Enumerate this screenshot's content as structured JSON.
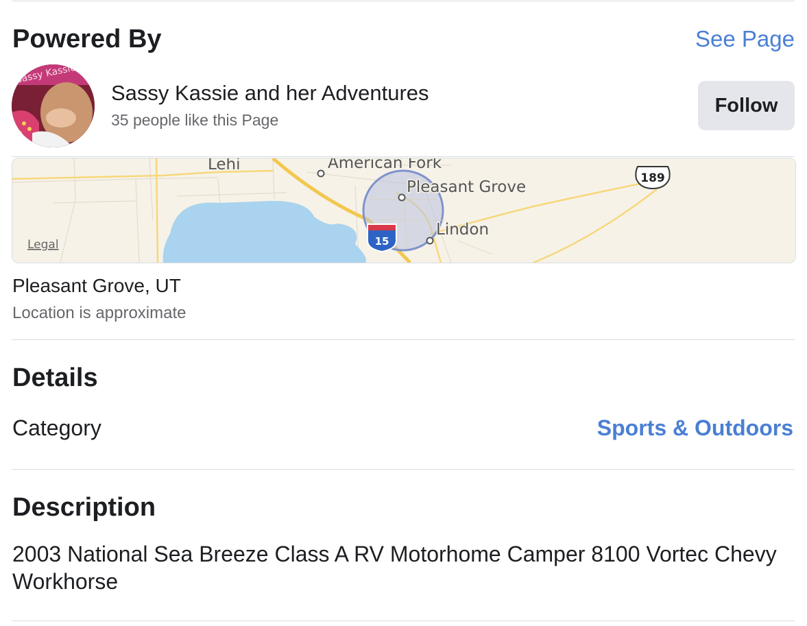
{
  "powered_by": {
    "title": "Powered By",
    "see_page_label": "See Page"
  },
  "page": {
    "name": "Sassy Kassie and her Adventures",
    "likes_text": "35 people like this Page",
    "follow_label": "Follow",
    "avatar_banner_text": "Sassy Kassie"
  },
  "map": {
    "labels": {
      "lehi": "Lehi",
      "american_fork": "American Fork",
      "pleasant_grove": "Pleasant Grove",
      "lindon": "Lindon",
      "legal": "Legal",
      "interstate": "15",
      "us_route": "189"
    }
  },
  "location": {
    "name": "Pleasant Grove, UT",
    "note": "Location is approximate"
  },
  "details": {
    "title": "Details",
    "category_label": "Category",
    "category_value": "Sports & Outdoors"
  },
  "description": {
    "title": "Description",
    "text": "2003 National Sea Breeze Class A RV Motorhome Camper 8100 Vortec Chevy Workhorse"
  },
  "colors": {
    "link": "#4a7fd4",
    "divider": "#dadde1",
    "button_bg": "#e4e6eb",
    "map_water": "#a9d3ee",
    "map_land": "#f6f2e8"
  }
}
